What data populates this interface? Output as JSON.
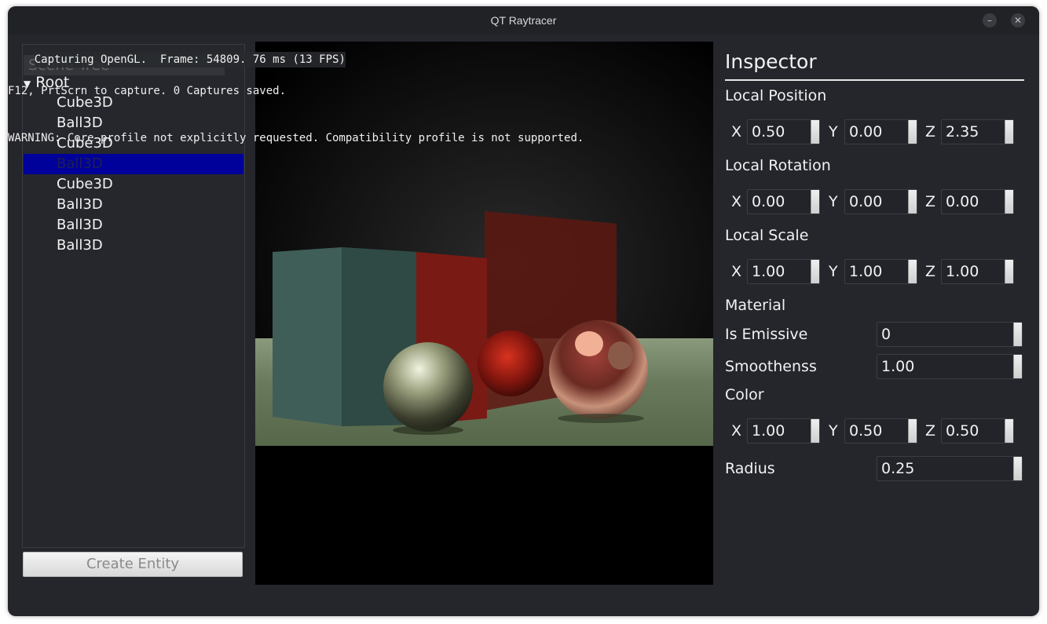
{
  "window": {
    "title": "QT Raytracer",
    "minimize_glyph": "–",
    "close_glyph": "✕"
  },
  "overlay": {
    "line1": "Capturing OpenGL.  Frame: 54809. 76 ms (13 FPS)",
    "line2": "F12, PrtScrn to capture. 0 Captures saved.",
    "line3": "WARNING: Core profile not explicitly requested. Compatibility profile is not supported."
  },
  "scene_tree": {
    "title": "Scene Tree",
    "root": "Root",
    "items": [
      "Cube3D",
      "Ball3D",
      "Cube3D",
      "Ball3D",
      "Cube3D",
      "Ball3D",
      "Ball3D",
      "Ball3D"
    ],
    "selected_index": 3
  },
  "create_button": "Create Entity",
  "inspector": {
    "title": "Inspector",
    "axis_x": "X",
    "axis_y": "Y",
    "axis_z": "Z",
    "local_position": {
      "label": "Local Position",
      "x": "0.50",
      "y": "0.00",
      "z": "2.35"
    },
    "local_rotation": {
      "label": "Local Rotation",
      "x": "0.00",
      "y": "0.00",
      "z": "0.00"
    },
    "local_scale": {
      "label": "Local Scale",
      "x": "1.00",
      "y": "1.00",
      "z": "1.00"
    },
    "material_label": "Material",
    "is_emissive": {
      "label": "Is Emissive",
      "value": "0"
    },
    "smoothness": {
      "label": "Smoothenss",
      "value": "1.00"
    },
    "color": {
      "label": "Color",
      "x": "1.00",
      "y": "0.50",
      "z": "0.50"
    },
    "radius": {
      "label": "Radius",
      "value": "0.25"
    }
  },
  "colors": {
    "window_bg": "#24262c",
    "selection": "#00009a",
    "floor": "#5a6a4e",
    "cube_teal": "#3d5a54",
    "cube_red": "#7a1a14"
  }
}
